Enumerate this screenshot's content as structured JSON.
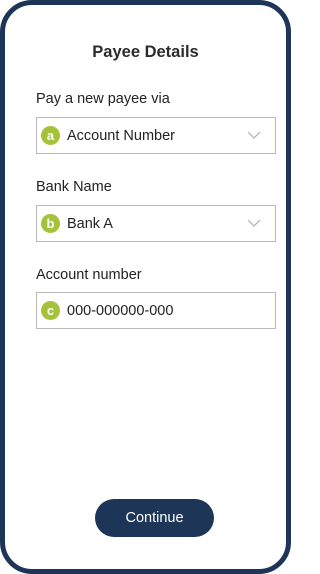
{
  "title": "Payee Details",
  "fields": [
    {
      "label": "Pay a new payee via",
      "badge": "a",
      "value": "Account Number"
    },
    {
      "label": "Bank Name",
      "badge": "b",
      "value": "Bank A"
    },
    {
      "label": "Account number",
      "badge": "c",
      "value": "000-000000-000"
    }
  ],
  "continue_label": "Continue",
  "colors": {
    "frame": "#1d3557",
    "badge": "#a6c23a",
    "border": "#b9b9b9"
  },
  "icons": [
    "chevron-down-icon"
  ]
}
